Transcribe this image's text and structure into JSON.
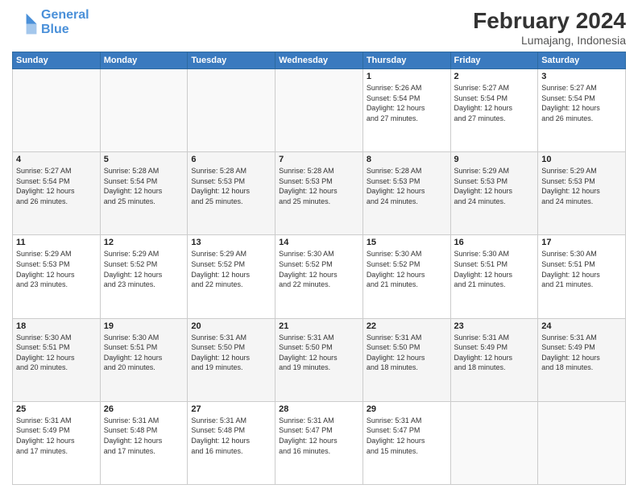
{
  "logo": {
    "line1": "General",
    "line2": "Blue"
  },
  "title": "February 2024",
  "location": "Lumajang, Indonesia",
  "days_of_week": [
    "Sunday",
    "Monday",
    "Tuesday",
    "Wednesday",
    "Thursday",
    "Friday",
    "Saturday"
  ],
  "weeks": [
    [
      {
        "day": "",
        "info": ""
      },
      {
        "day": "",
        "info": ""
      },
      {
        "day": "",
        "info": ""
      },
      {
        "day": "",
        "info": ""
      },
      {
        "day": "1",
        "info": "Sunrise: 5:26 AM\nSunset: 5:54 PM\nDaylight: 12 hours\nand 27 minutes."
      },
      {
        "day": "2",
        "info": "Sunrise: 5:27 AM\nSunset: 5:54 PM\nDaylight: 12 hours\nand 27 minutes."
      },
      {
        "day": "3",
        "info": "Sunrise: 5:27 AM\nSunset: 5:54 PM\nDaylight: 12 hours\nand 26 minutes."
      }
    ],
    [
      {
        "day": "4",
        "info": "Sunrise: 5:27 AM\nSunset: 5:54 PM\nDaylight: 12 hours\nand 26 minutes."
      },
      {
        "day": "5",
        "info": "Sunrise: 5:28 AM\nSunset: 5:54 PM\nDaylight: 12 hours\nand 25 minutes."
      },
      {
        "day": "6",
        "info": "Sunrise: 5:28 AM\nSunset: 5:53 PM\nDaylight: 12 hours\nand 25 minutes."
      },
      {
        "day": "7",
        "info": "Sunrise: 5:28 AM\nSunset: 5:53 PM\nDaylight: 12 hours\nand 25 minutes."
      },
      {
        "day": "8",
        "info": "Sunrise: 5:28 AM\nSunset: 5:53 PM\nDaylight: 12 hours\nand 24 minutes."
      },
      {
        "day": "9",
        "info": "Sunrise: 5:29 AM\nSunset: 5:53 PM\nDaylight: 12 hours\nand 24 minutes."
      },
      {
        "day": "10",
        "info": "Sunrise: 5:29 AM\nSunset: 5:53 PM\nDaylight: 12 hours\nand 24 minutes."
      }
    ],
    [
      {
        "day": "11",
        "info": "Sunrise: 5:29 AM\nSunset: 5:53 PM\nDaylight: 12 hours\nand 23 minutes."
      },
      {
        "day": "12",
        "info": "Sunrise: 5:29 AM\nSunset: 5:52 PM\nDaylight: 12 hours\nand 23 minutes."
      },
      {
        "day": "13",
        "info": "Sunrise: 5:29 AM\nSunset: 5:52 PM\nDaylight: 12 hours\nand 22 minutes."
      },
      {
        "day": "14",
        "info": "Sunrise: 5:30 AM\nSunset: 5:52 PM\nDaylight: 12 hours\nand 22 minutes."
      },
      {
        "day": "15",
        "info": "Sunrise: 5:30 AM\nSunset: 5:52 PM\nDaylight: 12 hours\nand 21 minutes."
      },
      {
        "day": "16",
        "info": "Sunrise: 5:30 AM\nSunset: 5:51 PM\nDaylight: 12 hours\nand 21 minutes."
      },
      {
        "day": "17",
        "info": "Sunrise: 5:30 AM\nSunset: 5:51 PM\nDaylight: 12 hours\nand 21 minutes."
      }
    ],
    [
      {
        "day": "18",
        "info": "Sunrise: 5:30 AM\nSunset: 5:51 PM\nDaylight: 12 hours\nand 20 minutes."
      },
      {
        "day": "19",
        "info": "Sunrise: 5:30 AM\nSunset: 5:51 PM\nDaylight: 12 hours\nand 20 minutes."
      },
      {
        "day": "20",
        "info": "Sunrise: 5:31 AM\nSunset: 5:50 PM\nDaylight: 12 hours\nand 19 minutes."
      },
      {
        "day": "21",
        "info": "Sunrise: 5:31 AM\nSunset: 5:50 PM\nDaylight: 12 hours\nand 19 minutes."
      },
      {
        "day": "22",
        "info": "Sunrise: 5:31 AM\nSunset: 5:50 PM\nDaylight: 12 hours\nand 18 minutes."
      },
      {
        "day": "23",
        "info": "Sunrise: 5:31 AM\nSunset: 5:49 PM\nDaylight: 12 hours\nand 18 minutes."
      },
      {
        "day": "24",
        "info": "Sunrise: 5:31 AM\nSunset: 5:49 PM\nDaylight: 12 hours\nand 18 minutes."
      }
    ],
    [
      {
        "day": "25",
        "info": "Sunrise: 5:31 AM\nSunset: 5:49 PM\nDaylight: 12 hours\nand 17 minutes."
      },
      {
        "day": "26",
        "info": "Sunrise: 5:31 AM\nSunset: 5:48 PM\nDaylight: 12 hours\nand 17 minutes."
      },
      {
        "day": "27",
        "info": "Sunrise: 5:31 AM\nSunset: 5:48 PM\nDaylight: 12 hours\nand 16 minutes."
      },
      {
        "day": "28",
        "info": "Sunrise: 5:31 AM\nSunset: 5:47 PM\nDaylight: 12 hours\nand 16 minutes."
      },
      {
        "day": "29",
        "info": "Sunrise: 5:31 AM\nSunset: 5:47 PM\nDaylight: 12 hours\nand 15 minutes."
      },
      {
        "day": "",
        "info": ""
      },
      {
        "day": "",
        "info": ""
      }
    ]
  ]
}
